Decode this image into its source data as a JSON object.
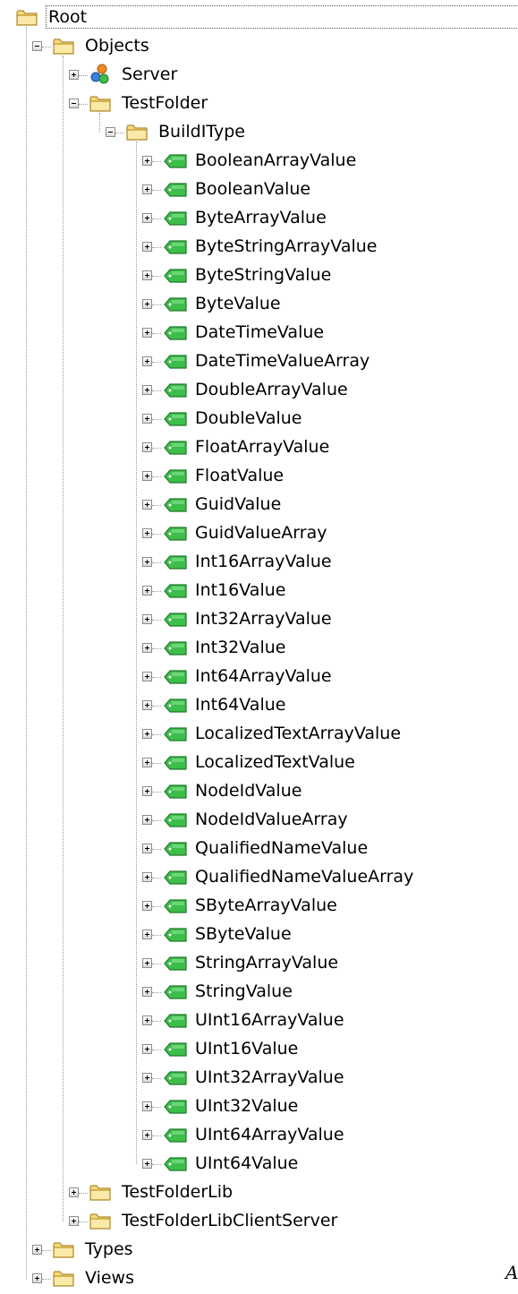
{
  "tree": {
    "root": {
      "label": "Root",
      "icon": "folder-icon",
      "expanded": true,
      "selected": true,
      "children": [
        {
          "label": "Objects",
          "icon": "folder-icon",
          "expanded": true,
          "children": [
            {
              "label": "Server",
              "icon": "server-icon",
              "expanded": false
            },
            {
              "label": "TestFolder",
              "icon": "folder-icon",
              "expanded": true,
              "children": [
                {
                  "label": "BuildIType",
                  "icon": "folder-icon",
                  "expanded": true,
                  "children": [
                    {
                      "label": "BooleanArrayValue",
                      "icon": "variable-tag-icon",
                      "expanded": false
                    },
                    {
                      "label": "BooleanValue",
                      "icon": "variable-tag-icon",
                      "expanded": false
                    },
                    {
                      "label": "ByteArrayValue",
                      "icon": "variable-tag-icon",
                      "expanded": false
                    },
                    {
                      "label": "ByteStringArrayValue",
                      "icon": "variable-tag-icon",
                      "expanded": false
                    },
                    {
                      "label": "ByteStringValue",
                      "icon": "variable-tag-icon",
                      "expanded": false
                    },
                    {
                      "label": "ByteValue",
                      "icon": "variable-tag-icon",
                      "expanded": false
                    },
                    {
                      "label": "DateTimeValue",
                      "icon": "variable-tag-icon",
                      "expanded": false
                    },
                    {
                      "label": "DateTimeValueArray",
                      "icon": "variable-tag-icon",
                      "expanded": false
                    },
                    {
                      "label": "DoubleArrayValue",
                      "icon": "variable-tag-icon",
                      "expanded": false
                    },
                    {
                      "label": "DoubleValue",
                      "icon": "variable-tag-icon",
                      "expanded": false
                    },
                    {
                      "label": "FloatArrayValue",
                      "icon": "variable-tag-icon",
                      "expanded": false
                    },
                    {
                      "label": "FloatValue",
                      "icon": "variable-tag-icon",
                      "expanded": false
                    },
                    {
                      "label": "GuidValue",
                      "icon": "variable-tag-icon",
                      "expanded": false
                    },
                    {
                      "label": "GuidValueArray",
                      "icon": "variable-tag-icon",
                      "expanded": false
                    },
                    {
                      "label": "Int16ArrayValue",
                      "icon": "variable-tag-icon",
                      "expanded": false
                    },
                    {
                      "label": "Int16Value",
                      "icon": "variable-tag-icon",
                      "expanded": false
                    },
                    {
                      "label": "Int32ArrayValue",
                      "icon": "variable-tag-icon",
                      "expanded": false
                    },
                    {
                      "label": "Int32Value",
                      "icon": "variable-tag-icon",
                      "expanded": false
                    },
                    {
                      "label": "Int64ArrayValue",
                      "icon": "variable-tag-icon",
                      "expanded": false
                    },
                    {
                      "label": "Int64Value",
                      "icon": "variable-tag-icon",
                      "expanded": false
                    },
                    {
                      "label": "LocalizedTextArrayValue",
                      "icon": "variable-tag-icon",
                      "expanded": false
                    },
                    {
                      "label": "LocalizedTextValue",
                      "icon": "variable-tag-icon",
                      "expanded": false
                    },
                    {
                      "label": "NodeIdValue",
                      "icon": "variable-tag-icon",
                      "expanded": false
                    },
                    {
                      "label": "NodeIdValueArray",
                      "icon": "variable-tag-icon",
                      "expanded": false
                    },
                    {
                      "label": "QualifiedNameValue",
                      "icon": "variable-tag-icon",
                      "expanded": false
                    },
                    {
                      "label": "QualifiedNameValueArray",
                      "icon": "variable-tag-icon",
                      "expanded": false
                    },
                    {
                      "label": "SByteArrayValue",
                      "icon": "variable-tag-icon",
                      "expanded": false
                    },
                    {
                      "label": "SByteValue",
                      "icon": "variable-tag-icon",
                      "expanded": false
                    },
                    {
                      "label": "StringArrayValue",
                      "icon": "variable-tag-icon",
                      "expanded": false
                    },
                    {
                      "label": "StringValue",
                      "icon": "variable-tag-icon",
                      "expanded": false
                    },
                    {
                      "label": "UInt16ArrayValue",
                      "icon": "variable-tag-icon",
                      "expanded": false
                    },
                    {
                      "label": "UInt16Value",
                      "icon": "variable-tag-icon",
                      "expanded": false
                    },
                    {
                      "label": "UInt32ArrayValue",
                      "icon": "variable-tag-icon",
                      "expanded": false
                    },
                    {
                      "label": "UInt32Value",
                      "icon": "variable-tag-icon",
                      "expanded": false
                    },
                    {
                      "label": "UInt64ArrayValue",
                      "icon": "variable-tag-icon",
                      "expanded": false
                    },
                    {
                      "label": "UInt64Value",
                      "icon": "variable-tag-icon",
                      "expanded": false
                    }
                  ]
                }
              ]
            },
            {
              "label": "TestFolderLib",
              "icon": "folder-icon",
              "expanded": false
            },
            {
              "label": "TestFolderLibClientServer",
              "icon": "folder-icon",
              "expanded": false
            }
          ]
        },
        {
          "label": "Types",
          "icon": "folder-icon",
          "expanded": false
        },
        {
          "label": "Views",
          "icon": "folder-icon",
          "expanded": false
        }
      ]
    }
  },
  "corner_text": "A",
  "colors": {
    "folder_fill": "#f5d97a",
    "folder_stroke": "#b08a2e",
    "tag_fill": "#3dbd4a",
    "tag_stroke": "#1f7a2a",
    "tree_line": "#9a9a9a"
  }
}
